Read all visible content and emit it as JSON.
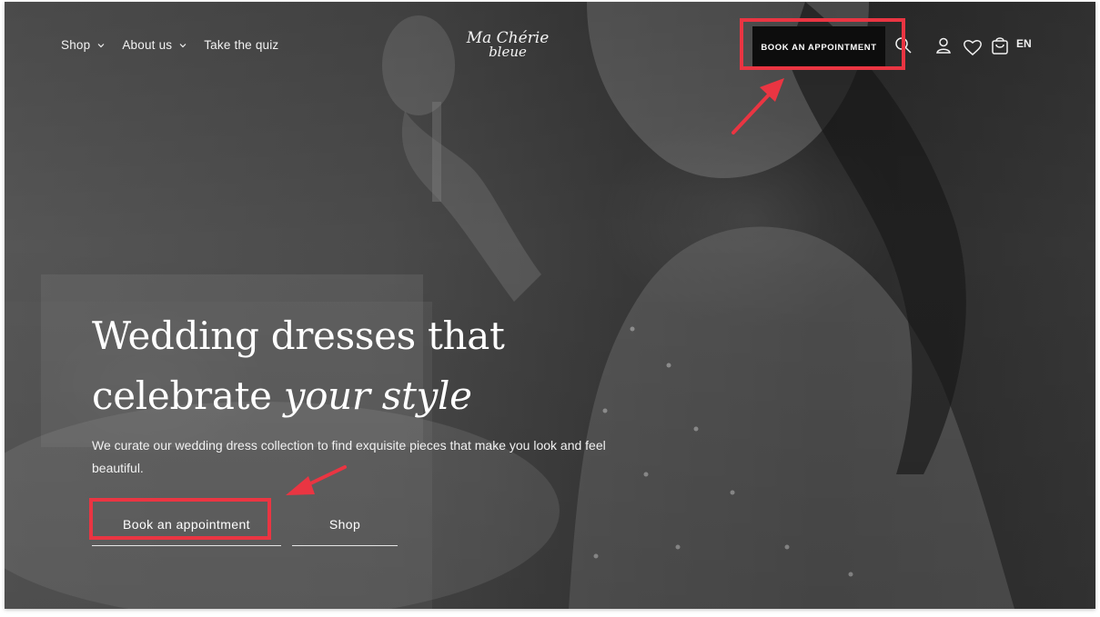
{
  "nav": {
    "items": [
      {
        "label": "Shop",
        "has_dropdown": true
      },
      {
        "label": "About us",
        "has_dropdown": true
      },
      {
        "label": "Take the quiz",
        "has_dropdown": false
      }
    ]
  },
  "logo": {
    "main": "Ma Chérie",
    "sub": "bleue"
  },
  "header_actions": {
    "book_label": "BOOK AN APPOINTMENT",
    "language": "EN",
    "icons": [
      "search-icon",
      "account-icon",
      "wishlist-heart-icon",
      "cart-bag-icon"
    ]
  },
  "hero": {
    "title_line1": "Wedding dresses that",
    "title_line2_plain": "celebrate ",
    "title_line2_em": "your style",
    "subtitle": "We curate our wedding dress collection to find exquisite pieces that make you look and feel beautiful.",
    "primary_cta": "Book an appointment",
    "secondary_cta": "Shop"
  },
  "annotations": {
    "color": "#ea3542"
  }
}
